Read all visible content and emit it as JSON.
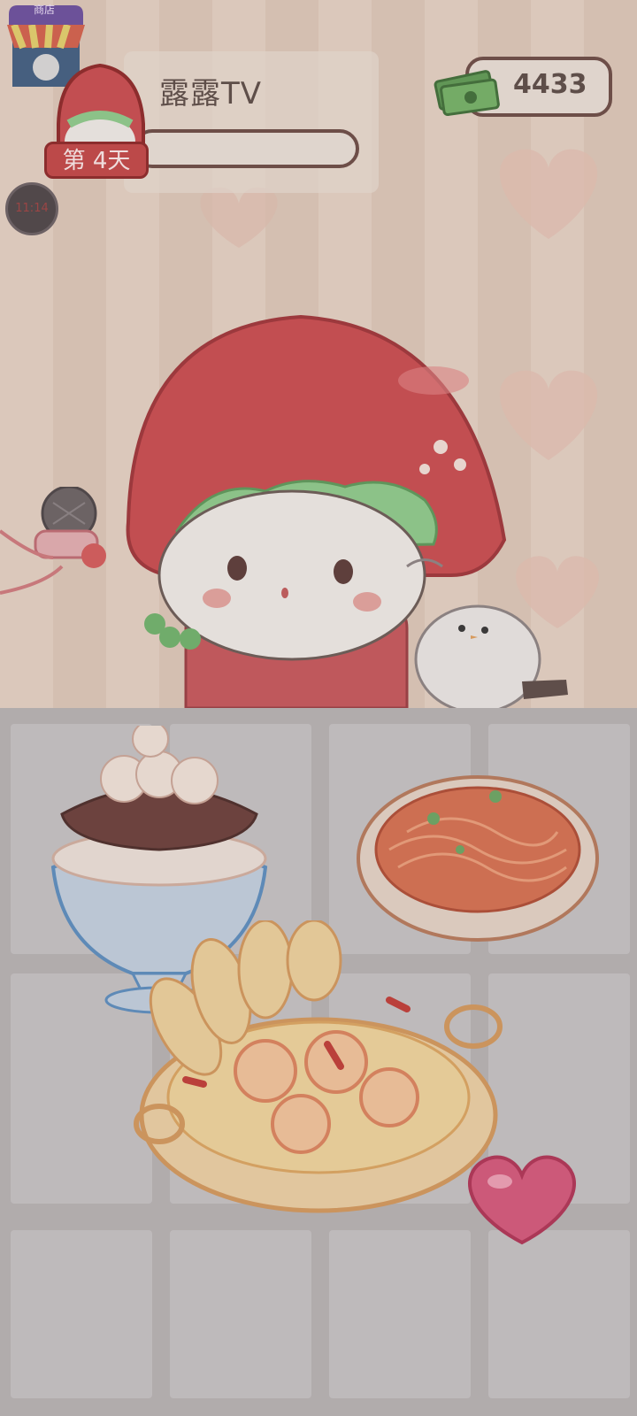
{
  "hud": {
    "shop_label": "商店",
    "channel_name": "露露TV",
    "day_label": "第 4天",
    "money": "4433",
    "timer": "11:14",
    "progress": 0.0
  },
  "scene": {
    "dishes": [
      "shaved-ice-dessert",
      "spaghetti",
      "shrimp-bake"
    ],
    "colors": {
      "accent": "#c54545",
      "frame": "#6b4a44",
      "panel": "#ede3da"
    }
  }
}
